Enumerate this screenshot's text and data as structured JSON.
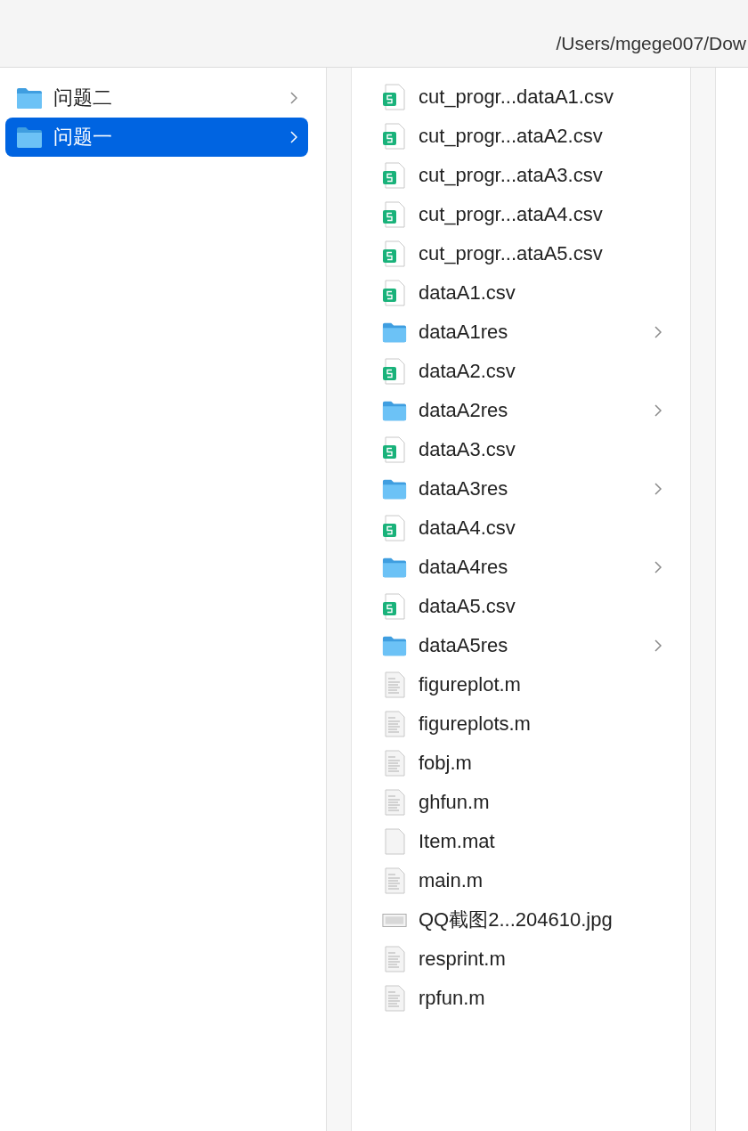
{
  "toolbar": {
    "path": "/Users/mgege007/Dow"
  },
  "sidebar": {
    "items": [
      {
        "name": "问题二",
        "selected": false
      },
      {
        "name": "问题一",
        "selected": true
      }
    ]
  },
  "files": [
    {
      "name": "cut_progr...dataA1.csv",
      "kind": "csv"
    },
    {
      "name": "cut_progr...ataA2.csv",
      "kind": "csv"
    },
    {
      "name": "cut_progr...ataA3.csv",
      "kind": "csv"
    },
    {
      "name": "cut_progr...ataA4.csv",
      "kind": "csv"
    },
    {
      "name": "cut_progr...ataA5.csv",
      "kind": "csv"
    },
    {
      "name": "dataA1.csv",
      "kind": "csv"
    },
    {
      "name": "dataA1res",
      "kind": "folder"
    },
    {
      "name": "dataA2.csv",
      "kind": "csv"
    },
    {
      "name": "dataA2res",
      "kind": "folder"
    },
    {
      "name": "dataA3.csv",
      "kind": "csv"
    },
    {
      "name": "dataA3res",
      "kind": "folder"
    },
    {
      "name": "dataA4.csv",
      "kind": "csv"
    },
    {
      "name": "dataA4res",
      "kind": "folder"
    },
    {
      "name": "dataA5.csv",
      "kind": "csv"
    },
    {
      "name": "dataA5res",
      "kind": "folder"
    },
    {
      "name": "figureplot.m",
      "kind": "script"
    },
    {
      "name": "figureplots.m",
      "kind": "script"
    },
    {
      "name": "fobj.m",
      "kind": "script"
    },
    {
      "name": "ghfun.m",
      "kind": "script"
    },
    {
      "name": "Item.mat",
      "kind": "blank"
    },
    {
      "name": "main.m",
      "kind": "script"
    },
    {
      "name": "QQ截图2...204610.jpg",
      "kind": "image"
    },
    {
      "name": "resprint.m",
      "kind": "script"
    },
    {
      "name": "rpfun.m",
      "kind": "script"
    }
  ]
}
